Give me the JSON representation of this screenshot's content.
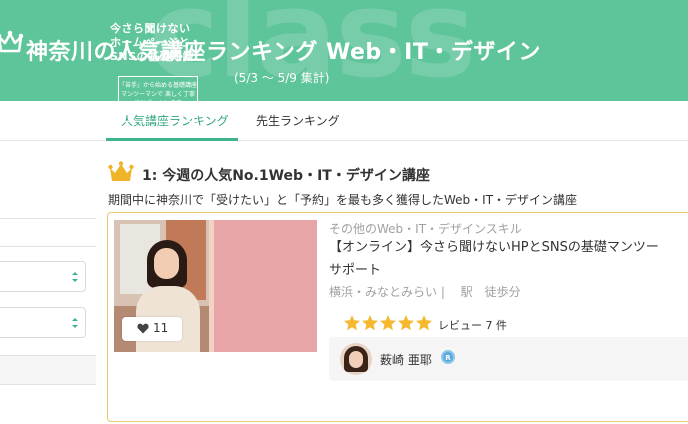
{
  "banner": {
    "watermark": "class",
    "title": "神奈川の人気講座ランキング Web・IT・デザイン",
    "period": "(5/3 〜 5/9 集計)"
  },
  "tabs": [
    {
      "label": "人気講座ランキング",
      "active": true
    },
    {
      "label": "先生ランキング",
      "active": false
    }
  ],
  "ranking": {
    "title": "1: 今週の人気No.1Web・IT・デザイン講座",
    "description": "期間中に神奈川で「受けたい」と「予約」を最も多く獲得したWeb・IT・デザイン講座"
  },
  "course": {
    "category": "その他のWeb・IT・デザインスキル",
    "title_line1": "【オンライン】今さら聞けないHPとSNSの基礎マンツー",
    "title_line2": "サポート",
    "location": "横浜・みなとみらい | 　駅　徒歩分",
    "thumbnail_text": "今さら聞けない ホームページと SNSの基礎知識",
    "thumbnail_subtext": "「苦手」から始める基礎講座 マンツーマンで 楽しく丁寧にサポートします",
    "likes": "11",
    "rating": 5,
    "review_label": "レビュー 7 件",
    "teacher_name": "薮崎 亜耶"
  },
  "colors": {
    "banner": "#5ec49a",
    "tab_active": "#2fa77d",
    "card_border": "#e9c96b",
    "star": "#f5b82e"
  }
}
